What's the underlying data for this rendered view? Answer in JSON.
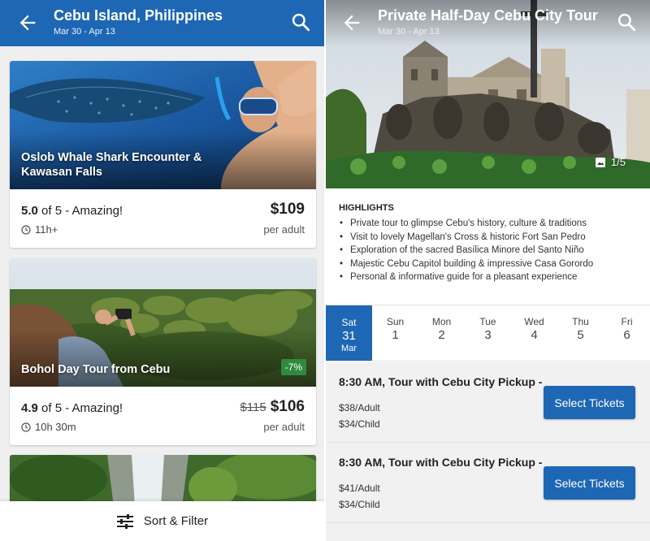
{
  "left": {
    "header": {
      "title": "Cebu Island, Philippines",
      "dates": "Mar 30 - Apr 13"
    },
    "cards": [
      {
        "image_title": "Oslob Whale Shark Encounter & Kawasan Falls",
        "rating": "5.0",
        "rating_suffix": " of 5 - Amazing!",
        "duration": "11h+",
        "price": "$109",
        "per": "per adult"
      },
      {
        "image_title": "Bohol Day Tour from Cebu",
        "badge": "-7%",
        "rating": "4.9",
        "rating_suffix": " of 5 - Amazing!",
        "duration": "10h 30m",
        "old_price": "$115",
        "price": "$106",
        "per": "per adult"
      }
    ],
    "footer": {
      "sort_filter": "Sort & Filter"
    }
  },
  "right": {
    "header": {
      "title": "Private Half-Day Cebu City Tour",
      "dates": "Mar 30 - Apr 13"
    },
    "photo_count": "1/5",
    "highlights": {
      "heading": "HIGHLIGHTS",
      "items": [
        "Private tour to glimpse Cebu's history, culture & traditions",
        "Visit to lovely Magellan's Cross & historic Fort San Pedro",
        "Exploration of the sacred Basílica Minore del Santo Niño",
        "Majestic Cebu Capitol building & impressive Casa Gorordo",
        "Personal & informative guide for a pleasant experience"
      ]
    },
    "dates": [
      {
        "day": "Sat",
        "date": "31",
        "month": "Mar",
        "selected": true
      },
      {
        "day": "Sun",
        "date": "1"
      },
      {
        "day": "Mon",
        "date": "2"
      },
      {
        "day": "Tue",
        "date": "3"
      },
      {
        "day": "Wed",
        "date": "4"
      },
      {
        "day": "Thu",
        "date": "5"
      },
      {
        "day": "Fri",
        "date": "6"
      }
    ],
    "offers": [
      {
        "title": "8:30 AM, Tour with Cebu City Pickup -",
        "adult": "$38/Adult",
        "child": "$34/Child",
        "button": "Select Tickets"
      },
      {
        "title": "8:30 AM, Tour with Cebu City Pickup -",
        "adult": "$41/Adult",
        "child": "$34/Child",
        "button": "Select Tickets"
      }
    ]
  },
  "colors": {
    "primary": "#1e67b5",
    "discount_badge": "#2f8a3f",
    "background": "#efefef"
  },
  "icons": {
    "back": "arrow-left-icon",
    "search": "search-icon",
    "clock": "clock-icon",
    "gallery": "photo-gallery-icon",
    "filter": "sliders-icon"
  }
}
